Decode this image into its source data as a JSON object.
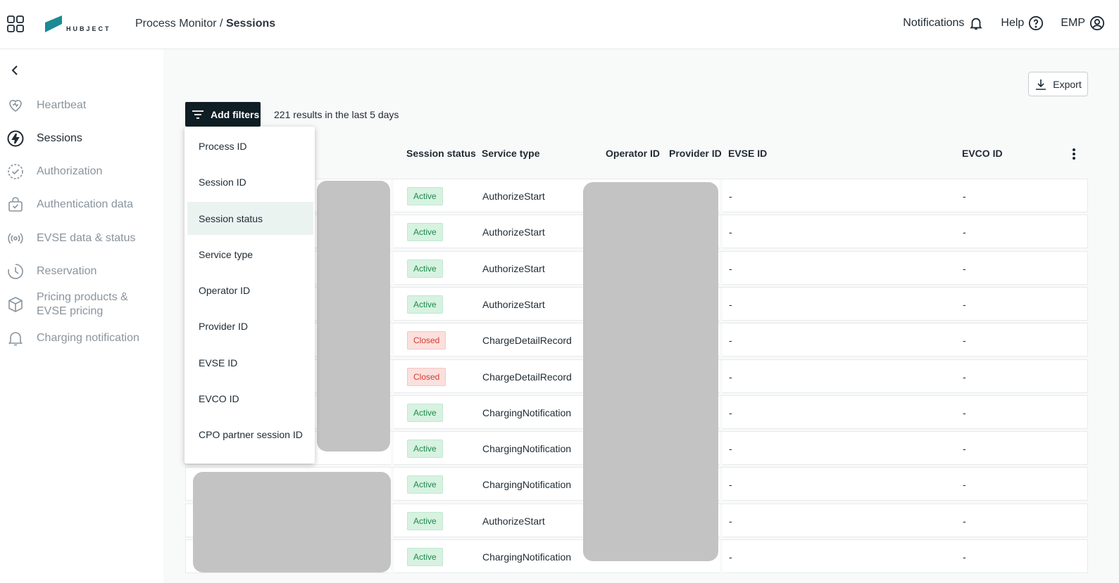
{
  "header": {
    "logo_text": "HUBJECT",
    "breadcrumb_parent": "Process Monitor",
    "breadcrumb_separator": " / ",
    "breadcrumb_current": "Sessions",
    "nav": {
      "notifications": "Notifications",
      "help": "Help",
      "account": "EMP"
    }
  },
  "sidebar": {
    "items": [
      {
        "label": "Heartbeat",
        "icon": "heart-icon"
      },
      {
        "label": "Sessions",
        "icon": "lightning-icon",
        "active": true
      },
      {
        "label": "Authorization",
        "icon": "check-circle-icon"
      },
      {
        "label": "Authentication data",
        "icon": "bag-icon"
      },
      {
        "label": "EVSE data & status",
        "icon": "broadcast-icon"
      },
      {
        "label": "Reservation",
        "icon": "clock-icon"
      },
      {
        "label": "Pricing products &",
        "label_line2": "EVSE pricing",
        "icon": "box-icon"
      },
      {
        "label": "Charging notification",
        "icon": "bell-icon"
      }
    ]
  },
  "toolbar": {
    "export_label": "Export",
    "filter_label": "Add filters",
    "results_text": "221 results in the last 5 days"
  },
  "filter_menu": {
    "items": [
      "Process ID",
      "Session ID",
      "Session status",
      "Service type",
      "Operator ID",
      "Provider ID",
      "EVSE ID",
      "EVCO ID",
      "CPO partner session ID"
    ],
    "hovered": "Session status"
  },
  "table": {
    "columns": {
      "session_status": "Session status",
      "service_type": "Service type",
      "operator_id": "Operator ID",
      "provider_id": "Provider ID",
      "evse_id": "EVSE ID",
      "evco_id": "EVCO ID"
    },
    "rows": [
      {
        "status": "Active",
        "service": "AuthorizeStart",
        "evse": "-",
        "evco": "-"
      },
      {
        "status": "Active",
        "service": "AuthorizeStart",
        "evse": "-",
        "evco": "-"
      },
      {
        "status": "Active",
        "service": "AuthorizeStart",
        "evse": "-",
        "evco": "-"
      },
      {
        "status": "Active",
        "service": "AuthorizeStart",
        "evse": "-",
        "evco": "-"
      },
      {
        "status": "Closed",
        "service": "ChargeDetailRecord",
        "evse": "-",
        "evco": "-"
      },
      {
        "status": "Closed",
        "service": "ChargeDetailRecord",
        "evse": "-",
        "evco": "-"
      },
      {
        "status": "Active",
        "service": "ChargingNotification",
        "evse": "-",
        "evco": "-"
      },
      {
        "status": "Active",
        "service": "ChargingNotification",
        "evse": "-",
        "evco": "-"
      },
      {
        "status": "Active",
        "service": "ChargingNotification",
        "evse": "-",
        "evco": "-"
      },
      {
        "status": "Active",
        "service": "AuthorizeStart",
        "evse": "-",
        "evco": "-"
      },
      {
        "status": "Active",
        "service": "ChargingNotification",
        "evse": "-",
        "evco": "-"
      }
    ]
  },
  "colors": {
    "primary_dark": "#0f1d24",
    "logo_teal": "#1b8a94",
    "active_green": "#1e8a4c",
    "closed_red": "#d23b2e"
  }
}
